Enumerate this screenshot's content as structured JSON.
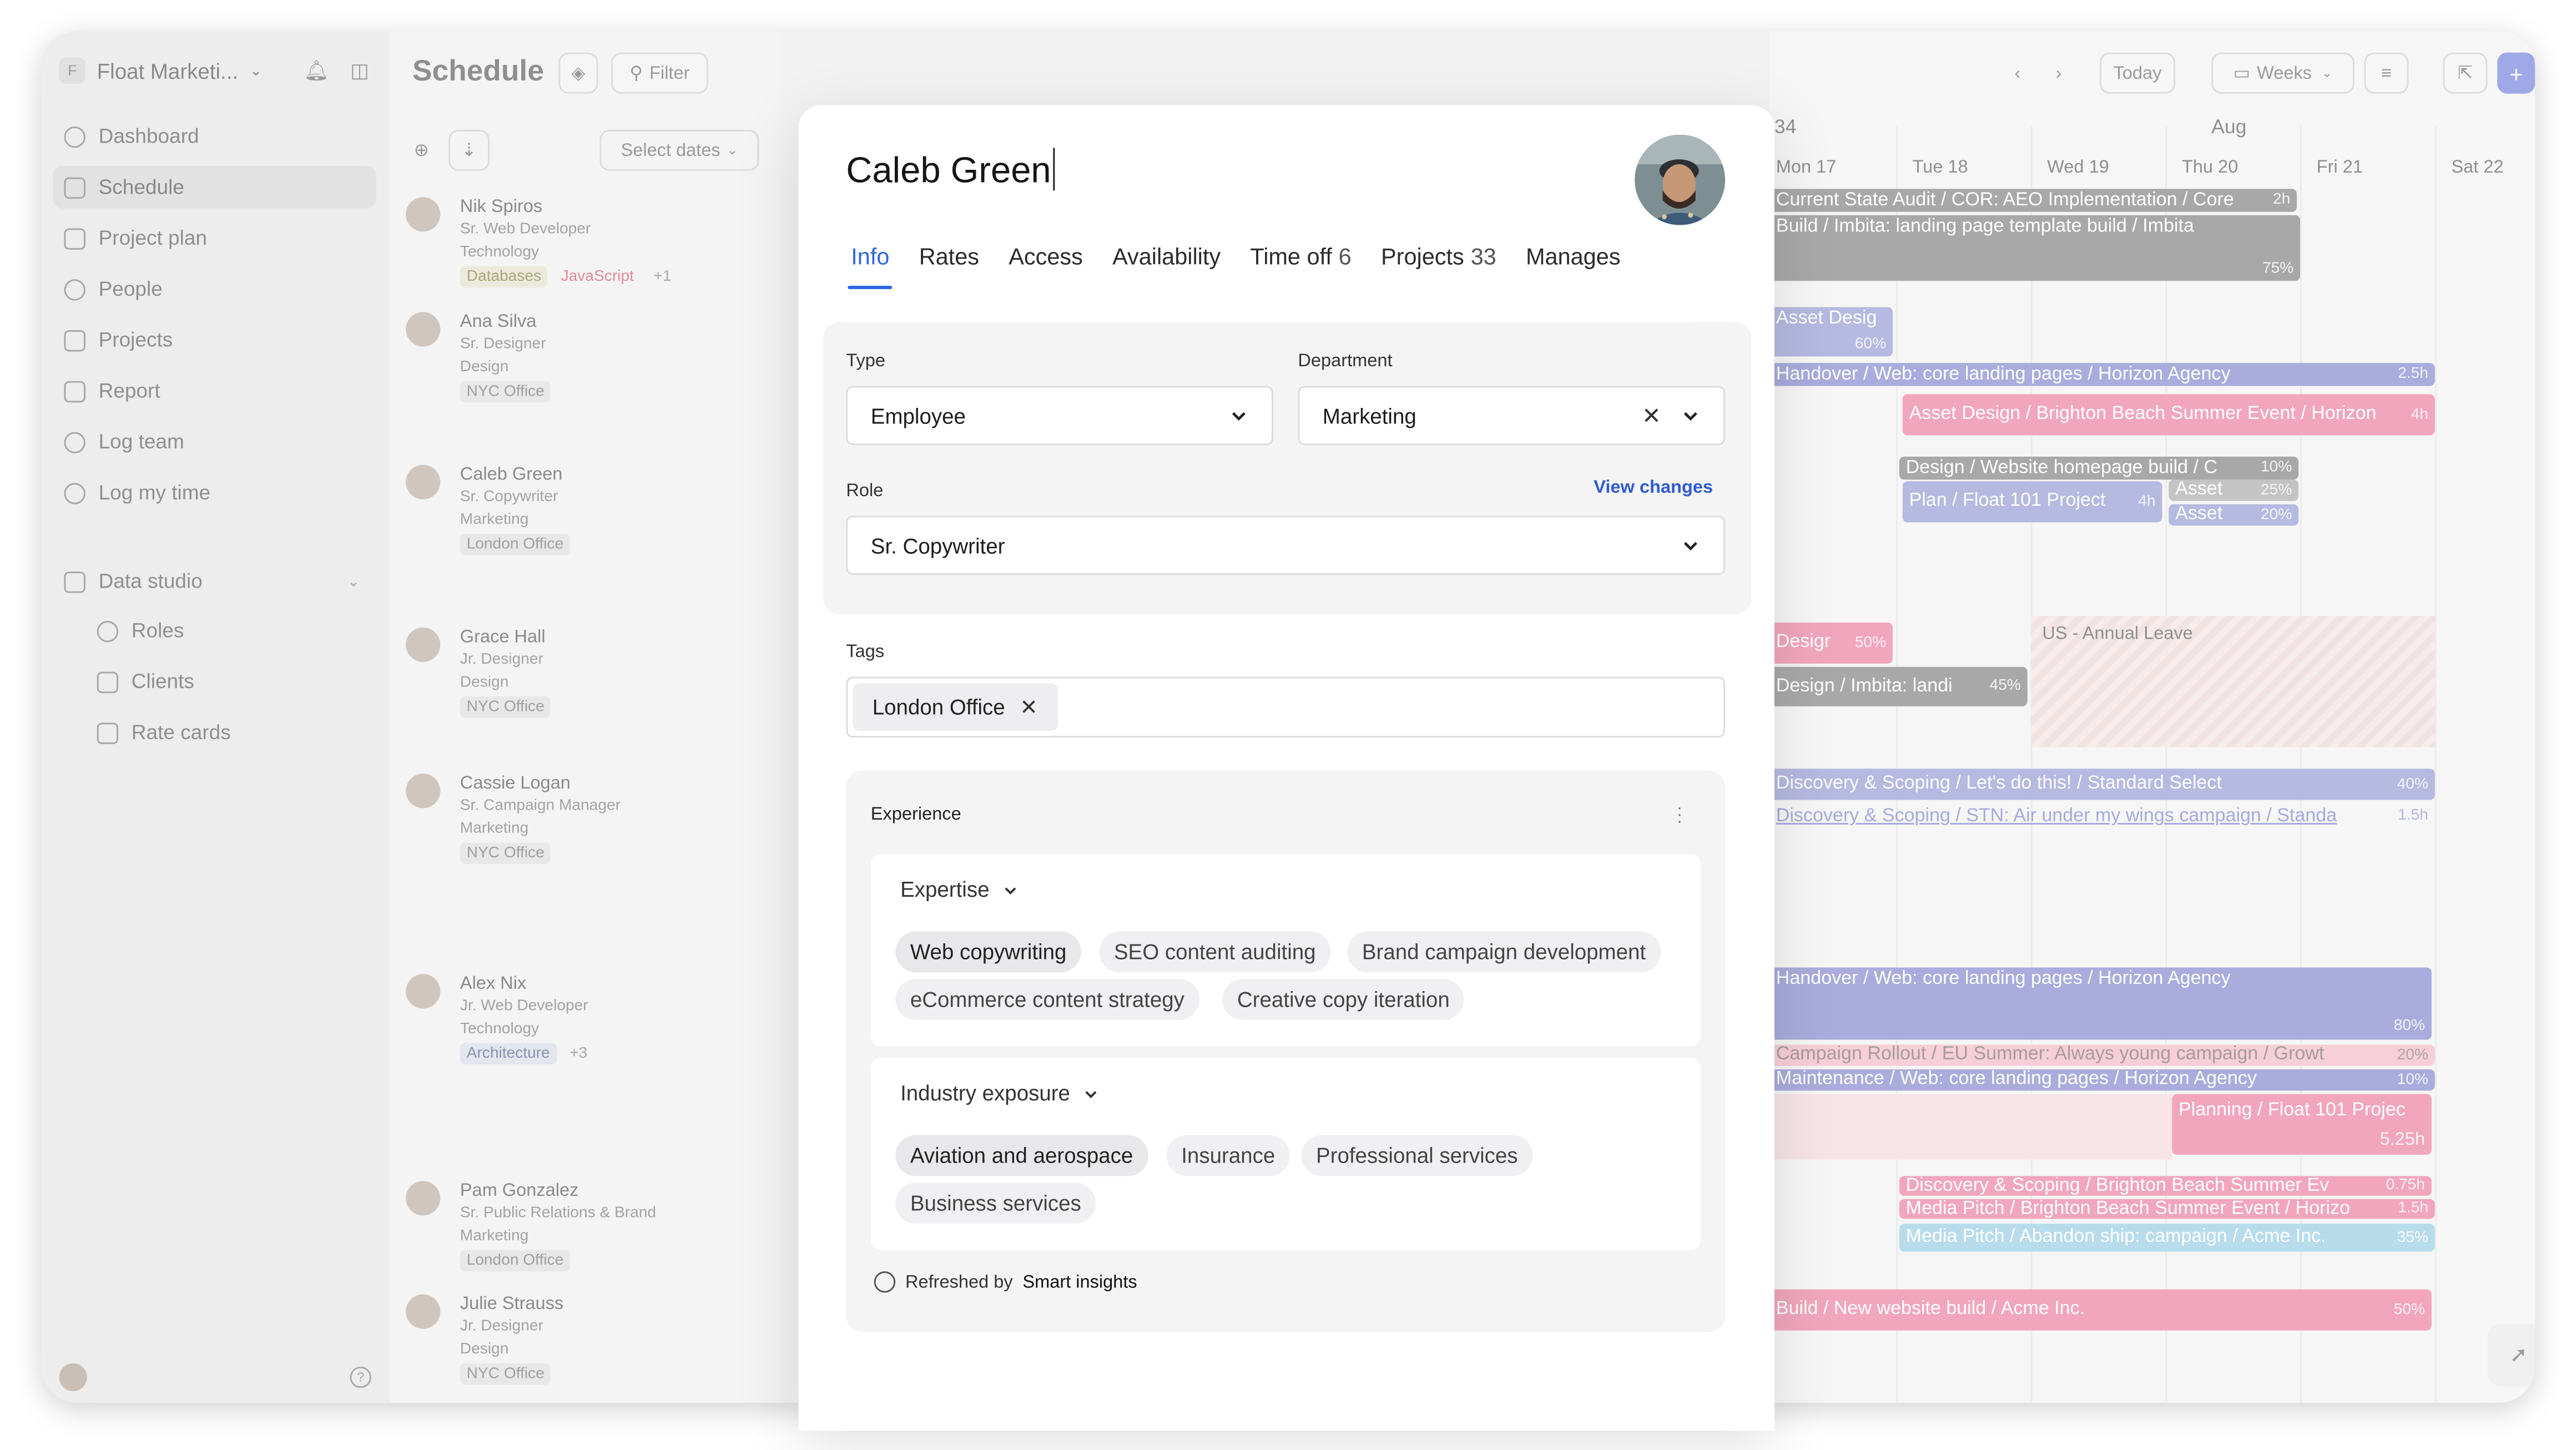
{
  "sidebar": {
    "workspace_initial": "F",
    "workspace_name": "Float Marketi...",
    "nav": [
      {
        "label": "Dashboard"
      },
      {
        "label": "Schedule"
      },
      {
        "label": "Project plan"
      },
      {
        "label": "People"
      },
      {
        "label": "Projects"
      },
      {
        "label": "Report"
      },
      {
        "label": "Log team"
      },
      {
        "label": "Log my time"
      }
    ],
    "data_studio": {
      "label": "Data studio",
      "items": [
        {
          "label": "Roles"
        },
        {
          "label": "Clients"
        },
        {
          "label": "Rate cards"
        }
      ]
    },
    "help": "?"
  },
  "header": {
    "title": "Schedule",
    "filter_label": "Filter",
    "today_label": "Today",
    "view_label": "Weeks"
  },
  "people_panel": {
    "select_dates": "Select dates",
    "people": [
      {
        "name": "Nik Spiros",
        "role": "Sr. Web Developer",
        "department": "Technology",
        "tags": [
          "Databases",
          "JavaScript",
          "+1"
        ]
      },
      {
        "name": "Ana Silva",
        "role": "Sr. Designer",
        "department": "Design",
        "tags": [
          "NYC Office"
        ]
      },
      {
        "name": "Caleb Green",
        "role": "Sr. Copywriter",
        "department": "Marketing",
        "tags": [
          "London Office"
        ]
      },
      {
        "name": "Grace Hall",
        "role": "Jr. Designer",
        "department": "Design",
        "tags": [
          "NYC Office"
        ]
      },
      {
        "name": "Cassie Logan",
        "role": "Sr. Campaign Manager",
        "department": "Marketing",
        "tags": [
          "NYC Office"
        ]
      },
      {
        "name": "Alex Nix",
        "role": "Jr. Web Developer",
        "department": "Technology",
        "tags": [
          "Architecture",
          "+3"
        ]
      },
      {
        "name": "Pam Gonzalez",
        "role": "Sr. Public Relations & Brand",
        "department": "Marketing",
        "tags": [
          "London Office"
        ]
      },
      {
        "name": "Julie Strauss",
        "role": "Jr. Designer",
        "department": "Design",
        "tags": [
          "NYC Office"
        ]
      }
    ]
  },
  "calendar": {
    "week_number": "34",
    "month": "Aug",
    "days": [
      "Mon 17",
      "Tue 18",
      "Wed 19",
      "Thu 20",
      "Fri 21",
      "Sat 22"
    ],
    "leave_label": "US - Annual Leave",
    "bars": [
      {
        "text": "Current State Audit / COR: AEO Implementation / Core",
        "pct": "2h",
        "color": "g"
      },
      {
        "text": "Build / Imbita: landing page template build / Imbita",
        "pct": "75%",
        "color": "g"
      },
      {
        "text": "Asset Desig",
        "pct": "60%",
        "color": "bl"
      },
      {
        "text": "Handover / Web: core landing pages / Horizon Agency",
        "pct": "2.5h",
        "color": "bl2"
      },
      {
        "text": "Asset Design / Brighton Beach Summer Event / Horizon",
        "pct": "4h",
        "color": "pk"
      },
      {
        "text": "Design / Website homepage build / C",
        "pct": "10%",
        "color": "g"
      },
      {
        "text": "Plan / Float 101 Project",
        "pct": "4h",
        "color": "bl"
      },
      {
        "text": "Asset",
        "pct": "25%",
        "color": "g"
      },
      {
        "text": "Asset",
        "pct": "20%",
        "color": "bl"
      },
      {
        "text": "Desigr",
        "pct": "50%",
        "color": "pk"
      },
      {
        "text": "Design / Imbita: landi",
        "pct": "45%",
        "color": "g"
      },
      {
        "text": "Discovery & Scoping / Let's do this! / Standard Select",
        "pct": "40%",
        "color": "bl"
      },
      {
        "text": "Discovery & Scoping / STN: Air under my wings campaign / Standa",
        "pct": "1.5h",
        "color": "bl"
      },
      {
        "text": "Handover / Web: core landing pages / Horizon Agency",
        "pct": "80%",
        "color": "bl2"
      },
      {
        "text": "Campaign Rollout / EU Summer: Always young campaign / Growt",
        "pct": "20%",
        "color": "pk"
      },
      {
        "text": "Maintenance / Web: core landing pages / Horizon Agency",
        "pct": "10%",
        "color": "bl2"
      },
      {
        "text": "Planning / Float 101 Projec",
        "pct": "5.25h",
        "color": "pk"
      },
      {
        "text": "Discovery & Scoping / Brighton Beach Summer Ev",
        "pct": "0.75h",
        "color": "pk"
      },
      {
        "text": "Media Pitch / Brighton Beach Summer Event / Horizo",
        "pct": "1.5h",
        "color": "pk"
      },
      {
        "text": "Media Pitch / Abandon ship: campaign / Acme Inc.",
        "pct": "35%",
        "color": "cy"
      },
      {
        "text": "Build / New website build / Acme Inc.",
        "pct": "50%",
        "color": "pk"
      }
    ]
  },
  "modal": {
    "name": "Caleb Green",
    "tabs": [
      {
        "label": "Info",
        "count": ""
      },
      {
        "label": "Rates",
        "count": ""
      },
      {
        "label": "Access",
        "count": ""
      },
      {
        "label": "Availability",
        "count": ""
      },
      {
        "label": "Time off",
        "count": "6"
      },
      {
        "label": "Projects",
        "count": "33"
      },
      {
        "label": "Manages",
        "count": ""
      }
    ],
    "type_label": "Type",
    "type_value": "Employee",
    "department_label": "Department",
    "department_value": "Marketing",
    "role_label": "Role",
    "view_changes": "View changes",
    "role_value": "Sr. Copywriter",
    "tags_label": "Tags",
    "tag_chip": "London Office",
    "experience": {
      "title": "Experience",
      "expertise_label": "Expertise",
      "expertise": [
        "Web copywriting",
        "SEO content auditing",
        "Brand campaign development",
        "eCommerce content strategy",
        "Creative copy iteration"
      ],
      "industry_label": "Industry exposure",
      "industry": [
        "Aviation and aerospace",
        "Insurance",
        "Professional services",
        "Business services"
      ],
      "refreshed_prefix": "Refreshed by",
      "refreshed_source": "Smart insights"
    }
  },
  "colors": {
    "accent": "#2f66e3",
    "bar_gray": "#a8a8a8",
    "bar_blue": "#b6b9e0",
    "bar_pink": "#f1a6bd",
    "bar_cyan": "#b8dcec"
  }
}
